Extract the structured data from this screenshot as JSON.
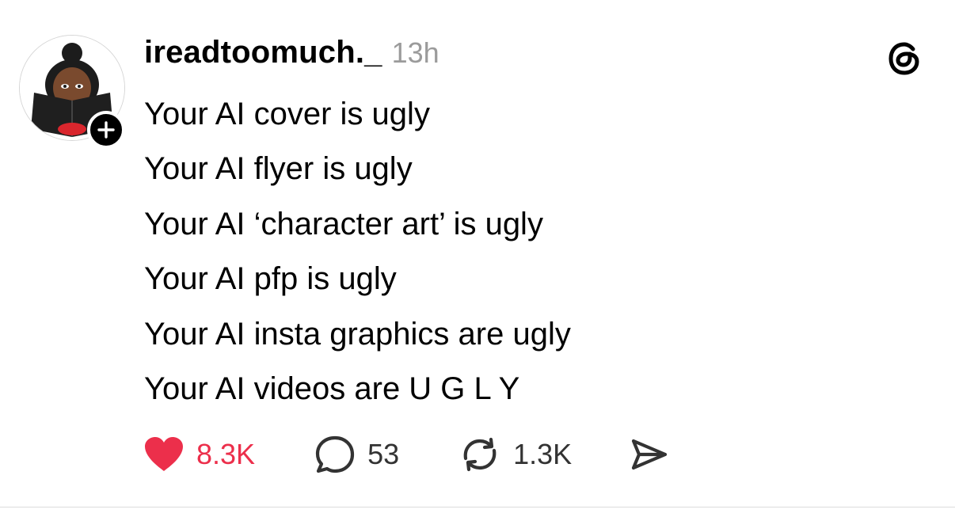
{
  "post": {
    "username": "ireadtoomuch._",
    "timestamp": "13h",
    "lines": [
      "Your AI cover is ugly",
      "Your AI flyer is ugly",
      "Your AI ‘character art’ is ugly",
      "Your AI pfp is ugly",
      "Your AI insta graphics are ugly",
      "Your AI videos are U G L Y"
    ]
  },
  "actions": {
    "likes": "8.3K",
    "replies": "53",
    "reposts": "1.3K"
  },
  "icons": {
    "like": "heart-icon",
    "reply": "speech-bubble-icon",
    "repost": "repost-arrows-icon",
    "share": "paper-plane-icon",
    "brand": "threads-logo-icon",
    "follow": "plus-icon"
  },
  "colors": {
    "like_accent": "#ec2f4b",
    "muted": "#9b9b9b",
    "text": "#000000"
  }
}
